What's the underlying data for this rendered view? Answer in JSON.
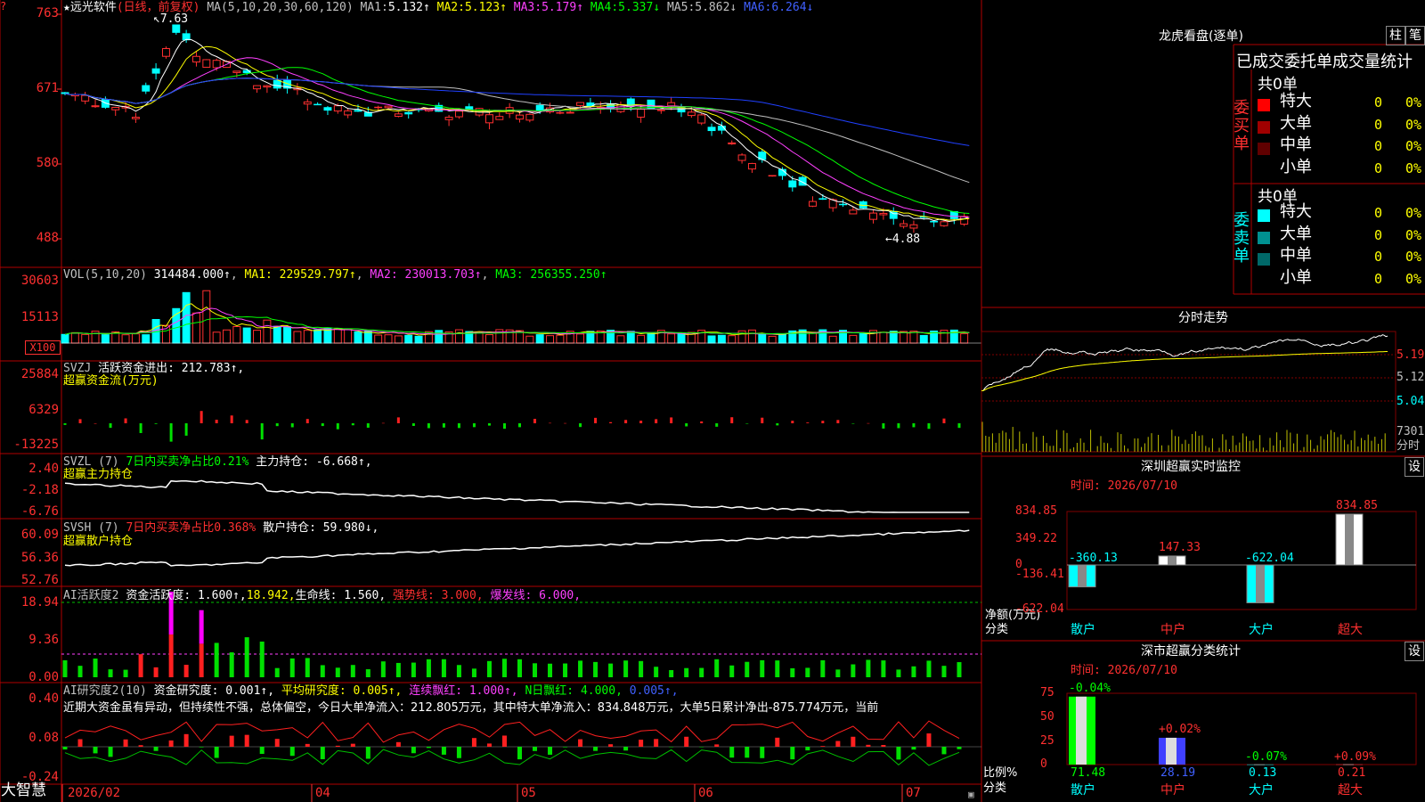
{
  "app": {
    "corner_icon": "?",
    "brand": "大智慧"
  },
  "price": {
    "name": "远光软件",
    "mode": "(日线，前复权)",
    "ma_label": "MA(5,10,20,30,60,120)",
    "ma": [
      {
        "k": "MA1:",
        "v": "5.132↑"
      },
      {
        "k": "MA2:",
        "v": "5.123↑"
      },
      {
        "k": "MA3:",
        "v": "5.179↑"
      },
      {
        "k": "MA4:",
        "v": "5.337↓"
      },
      {
        "k": "MA5:",
        "v": "5.862↓"
      },
      {
        "k": "MA6:",
        "v": "6.264↓"
      }
    ],
    "axis": [
      "763",
      "671",
      "580",
      "488"
    ],
    "hi_label": "7.63",
    "lo_label": "4.88"
  },
  "vol": {
    "label": "VOL(5,10,20)",
    "value": "314484.000↑",
    "ma": [
      {
        "k": "MA1:",
        "v": "229529.797↑"
      },
      {
        "k": "MA2:",
        "v": "230013.703↑"
      },
      {
        "k": "MA3:",
        "v": "256355.250↑"
      }
    ],
    "axis": [
      "30603",
      "15113"
    ],
    "unit": "X100"
  },
  "svzj": {
    "label": "SVZJ",
    "text": "活跃资金进出: 212.783↑,",
    "sub": "超赢资金流(万元)",
    "axis": [
      "25884",
      "6329",
      "-13225"
    ]
  },
  "svzl": {
    "label": "SVZL (7)",
    "t1": "7日内买卖净占比0.21%",
    "t2": "主力持仓: -6.668↑,",
    "sub": "超赢主力持仓",
    "axis": [
      "2.40",
      "-2.18",
      "-6.76"
    ]
  },
  "svsh": {
    "label": "SVSH (7)",
    "t1": "7日内买卖净占比0.368%",
    "t2": "散户持仓: 59.980↓,",
    "sub": "超赢散户持仓",
    "axis": [
      "60.09",
      "56.36",
      "52.76"
    ]
  },
  "ai1": {
    "label": "AI活跃度2",
    "t1": "资金活跃度: 1.600↑,",
    "t2": "18.942,",
    "t3": "生命线: 1.560,",
    "t4": "强势线: 3.000,",
    "t5": "爆发线: 6.000,",
    "axis": [
      "18.94",
      "9.36",
      "0.00"
    ]
  },
  "ai2": {
    "label": "AI研究度2(10)",
    "t1": "资金研究度: 0.001↑,",
    "t2": "平均研究度: 0.005↑,",
    "t3": "连续飘红: 1.000↑,",
    "t4": "N日飘红: 4.000,",
    "t5": "0.005↑,",
    "commentary": "近期大资金虽有异动，但持续性不强，总体偏空，今日大单净流入：212.805万元，其中特大单净流入：834.848万元，大单5日累计净出-875.774万元，当前",
    "axis": [
      "0.40",
      "0.08",
      "-0.24"
    ]
  },
  "xaxis": [
    "2026/02",
    "04",
    "05",
    "06",
    "07"
  ],
  "lhb": {
    "title": "龙虎看盘(逐单)",
    "btn1": "柱",
    "btn2": "笔",
    "header": "已成交委托单成交量统计",
    "buy": {
      "side": "委买单",
      "total": "共0单",
      "rows": [
        {
          "n": "特大",
          "c": "#ff0000",
          "v": "0",
          "p": "0%"
        },
        {
          "n": "大单",
          "c": "#a00000",
          "v": "0",
          "p": "0%"
        },
        {
          "n": "中单",
          "c": "#600000",
          "v": "0",
          "p": "0%"
        },
        {
          "n": "小单",
          "c": "",
          "v": "0",
          "p": "0%"
        }
      ]
    },
    "sell": {
      "side": "委卖单",
      "total": "共0单",
      "rows": [
        {
          "n": "特大",
          "c": "#00ffff",
          "v": "0",
          "p": "0%"
        },
        {
          "n": "大单",
          "c": "#009090",
          "v": "0",
          "p": "0%"
        },
        {
          "n": "中单",
          "c": "#006868",
          "v": "0",
          "p": "0%"
        },
        {
          "n": "小单",
          "c": "",
          "v": "0",
          "p": "0%"
        }
      ]
    }
  },
  "intraday": {
    "title": "分时走势",
    "axis": [
      "5.195",
      "5.120",
      "5.045"
    ],
    "vol_label": "7301",
    "vol_unit": "分时"
  },
  "monitor": {
    "title": "深圳超赢实时监控",
    "btn": "设",
    "time": "时间: 2026/07/10",
    "axis": [
      "834.85",
      "349.22",
      "0",
      "-136.41",
      "-622.04"
    ],
    "ylabel": "净额(万元)",
    "xlabel": "分类",
    "chart_data": {
      "type": "bar",
      "categories": [
        "散户",
        "中户",
        "大户",
        "超大"
      ],
      "values": [
        -360.13,
        147.33,
        -622.04,
        834.85
      ],
      "labels": [
        "-360.13",
        "147.33",
        "-622.04",
        "834.85"
      ],
      "ylim": [
        -622.04,
        834.85
      ]
    }
  },
  "classify": {
    "title": "深市超赢分类统计",
    "btn": "设",
    "time": "时间: 2026/07/10",
    "axis": [
      "75",
      "50",
      "25",
      "0"
    ],
    "ylabel": "比例%",
    "xlabel": "分类",
    "chart_data": {
      "type": "bar",
      "categories": [
        "散户",
        "中户",
        "大户",
        "超大"
      ],
      "values": [
        71.48,
        28.19,
        0.13,
        0.21
      ],
      "changes": [
        "-0.04%",
        "+0.02%",
        "-0.07%",
        "+0.09%"
      ],
      "labels": [
        "71.48",
        "28.19",
        "0.13",
        "0.21"
      ],
      "ylim": [
        0,
        75
      ]
    }
  },
  "colors": {
    "up": "#ff3030",
    "down": "#00ffff",
    "frame": "#b00000",
    "ma1": "#ffffff",
    "ma2": "#ffff00",
    "ma3": "#ff40ff",
    "ma4": "#00ff00",
    "ma5": "#c0c0c0",
    "ma6": "#2040ff"
  }
}
